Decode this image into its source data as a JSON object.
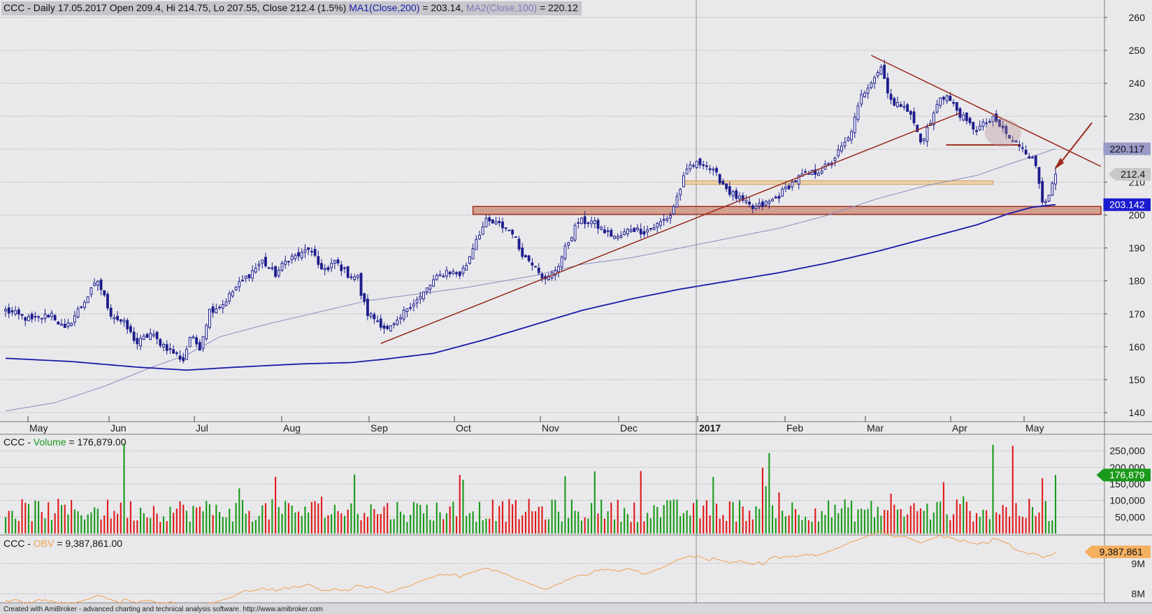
{
  "header": {
    "parts": [
      {
        "text": "CCC - Daily 17.05.2017 Open 209.4, Hi 214.75, Lo 207.55, Close 212.4 (1.5%) ",
        "color": "#111111"
      },
      {
        "text": "MA1(Close,200)",
        "color": "#1a1aa8"
      },
      {
        "text": " = 203.14, ",
        "color": "#111111"
      },
      {
        "text": "MA2(Close,100)",
        "color": "#7a7ab8"
      },
      {
        "text": " = 220.12",
        "color": "#111111"
      }
    ]
  },
  "volume_header": {
    "parts": [
      {
        "text": "CCC - ",
        "color": "#111111"
      },
      {
        "text": "Volume",
        "color": "#1a9a1a"
      },
      {
        "text": " = 176,879.00",
        "color": "#111111"
      }
    ]
  },
  "obv_header": {
    "parts": [
      {
        "text": "CCC - ",
        "color": "#111111"
      },
      {
        "text": "OBV",
        "color": "#f0a050"
      },
      {
        "text": " = 9,387,861.00",
        "color": "#111111"
      }
    ]
  },
  "footer": "Created with AmiBroker - advanced charting and technical analysis software. http://www.amibroker.com",
  "months": [
    {
      "label": "May",
      "bold": false
    },
    {
      "label": "Jun",
      "bold": false
    },
    {
      "label": "Jul",
      "bold": false
    },
    {
      "label": "Aug",
      "bold": false
    },
    {
      "label": "Sep",
      "bold": false
    },
    {
      "label": "Oct",
      "bold": false
    },
    {
      "label": "Nov",
      "bold": false
    },
    {
      "label": "Dec",
      "bold": false
    },
    {
      "label": "2017",
      "bold": true
    },
    {
      "label": "Feb",
      "bold": false
    },
    {
      "label": "Mar",
      "bold": false
    },
    {
      "label": "Apr",
      "bold": false
    },
    {
      "label": "May",
      "bold": false
    }
  ],
  "price_badges": [
    {
      "text": "220.117",
      "bg": "#9a9ac8",
      "fg": "#111111"
    },
    {
      "text": "212.4",
      "bg": "#c8c8c8",
      "fg": "#111111"
    },
    {
      "text": "203.142",
      "bg": "#1a1ad0",
      "fg": "#ffffff"
    }
  ],
  "volume_badge": {
    "text": "176,879",
    "bg": "#1a9a1a",
    "fg": "#ffffff"
  },
  "obv_badge": {
    "text": "9,387,861",
    "bg": "#f5b060",
    "fg": "#111111"
  },
  "colors": {
    "background": "#e9e9ec",
    "grid": "#9a9a9a",
    "candle": "#1c1c8c",
    "ma200": "#1a1aa8",
    "ma100": "#8a8ac0",
    "trendline": "#9a2a1a",
    "support_zone_fill": "#c8806a",
    "resist_zone_fill": "#f0c890",
    "vol_up": "#1a9a1a",
    "vol_down": "#e01a1a",
    "obv_line": "#f0a050"
  },
  "chart_data": [
    {
      "type": "candlestick",
      "title": "CCC - Daily 17.05.2017",
      "period": "2016-05 to 2017-05-17",
      "last": {
        "date": "17.05.2017",
        "open": 209.4,
        "high": 214.75,
        "low": 207.55,
        "close": 212.4,
        "change_pct": 1.5
      },
      "y_ticks": [
        140,
        150,
        160,
        170,
        180,
        190,
        200,
        210,
        220,
        230,
        240,
        250,
        260
      ],
      "ylim": [
        137,
        262
      ],
      "x_months": [
        "May",
        "Jun",
        "Jul",
        "Aug",
        "Sep",
        "Oct",
        "Nov",
        "Dec",
        "2017",
        "Feb",
        "Mar",
        "Apr",
        "May"
      ],
      "close_anchors": [
        [
          0,
          171
        ],
        [
          8,
          168
        ],
        [
          14,
          170
        ],
        [
          18,
          165
        ],
        [
          24,
          174
        ],
        [
          28,
          180
        ],
        [
          32,
          170
        ],
        [
          36,
          167
        ],
        [
          40,
          161
        ],
        [
          44,
          164
        ],
        [
          46,
          162
        ],
        [
          50,
          159
        ],
        [
          54,
          156
        ],
        [
          56,
          163
        ],
        [
          59,
          160
        ],
        [
          62,
          171
        ],
        [
          66,
          173
        ],
        [
          70,
          178
        ],
        [
          74,
          182
        ],
        [
          78,
          186
        ],
        [
          82,
          182
        ],
        [
          86,
          187
        ],
        [
          90,
          188
        ],
        [
          92,
          190
        ],
        [
          95,
          185
        ],
        [
          98,
          183
        ],
        [
          100,
          186
        ],
        [
          104,
          182
        ],
        [
          107,
          181
        ],
        [
          108,
          176
        ],
        [
          110,
          170
        ],
        [
          113,
          168
        ],
        [
          116,
          165
        ],
        [
          119,
          167
        ],
        [
          122,
          172
        ],
        [
          126,
          175
        ],
        [
          130,
          180
        ],
        [
          134,
          183
        ],
        [
          138,
          182
        ],
        [
          140,
          185
        ],
        [
          143,
          193
        ],
        [
          146,
          198
        ],
        [
          150,
          197
        ],
        [
          154,
          195
        ],
        [
          156,
          190
        ],
        [
          158,
          187
        ],
        [
          161,
          185
        ],
        [
          164,
          180
        ],
        [
          166,
          182
        ],
        [
          168,
          185
        ],
        [
          171,
          192
        ],
        [
          174,
          198
        ],
        [
          178,
          198
        ],
        [
          182,
          195
        ],
        [
          186,
          193
        ],
        [
          190,
          196
        ],
        [
          194,
          195
        ],
        [
          198,
          197
        ],
        [
          202,
          200
        ],
        [
          206,
          211
        ],
        [
          208,
          215
        ],
        [
          212,
          216
        ],
        [
          216,
          212
        ],
        [
          220,
          207
        ],
        [
          224,
          204
        ],
        [
          227,
          202
        ],
        [
          230,
          203
        ],
        [
          234,
          205
        ],
        [
          238,
          209
        ],
        [
          242,
          212
        ],
        [
          246,
          213
        ],
        [
          250,
          215
        ],
        [
          253,
          219
        ],
        [
          256,
          223
        ],
        [
          258,
          229
        ],
        [
          260,
          236
        ],
        [
          263,
          241
        ],
        [
          266,
          245
        ],
        [
          268,
          238
        ],
        [
          270,
          233
        ],
        [
          273,
          234
        ],
        [
          276,
          228
        ],
        [
          278,
          222
        ],
        [
          281,
          228
        ],
        [
          284,
          236
        ],
        [
          286,
          236
        ],
        [
          289,
          232
        ],
        [
          292,
          228
        ],
        [
          295,
          226
        ],
        [
          298,
          228
        ],
        [
          300,
          229
        ],
        [
          303,
          226
        ],
        [
          306,
          222
        ],
        [
          309,
          221
        ],
        [
          311,
          218
        ],
        [
          313,
          215
        ],
        [
          315,
          205
        ],
        [
          317,
          205
        ],
        [
          318,
          209
        ],
        [
          319,
          212.4
        ]
      ],
      "ma200": {
        "name": "MA1(Close,200)",
        "last": 203.14,
        "anchors": [
          [
            0,
            156.5
          ],
          [
            20,
            155.5
          ],
          [
            40,
            153.8
          ],
          [
            55,
            152.9
          ],
          [
            70,
            153.8
          ],
          [
            90,
            154.8
          ],
          [
            105,
            155.2
          ],
          [
            115,
            156.2
          ],
          [
            130,
            158
          ],
          [
            145,
            162
          ],
          [
            160,
            166.5
          ],
          [
            175,
            171
          ],
          [
            190,
            174.5
          ],
          [
            205,
            177.5
          ],
          [
            220,
            180
          ],
          [
            235,
            182.5
          ],
          [
            250,
            185.5
          ],
          [
            265,
            189
          ],
          [
            280,
            193
          ],
          [
            295,
            197
          ],
          [
            305,
            200.5
          ],
          [
            312,
            202.4
          ],
          [
            319,
            203.14
          ]
        ]
      },
      "ma100": {
        "name": "MA2(Close,100)",
        "last": 220.12,
        "anchors": [
          [
            0,
            140.5
          ],
          [
            15,
            143
          ],
          [
            30,
            148
          ],
          [
            45,
            154
          ],
          [
            55,
            157.5
          ],
          [
            65,
            163
          ],
          [
            80,
            167
          ],
          [
            95,
            170.5
          ],
          [
            110,
            174
          ],
          [
            125,
            176
          ],
          [
            140,
            178
          ],
          [
            160,
            181.5
          ],
          [
            175,
            185
          ],
          [
            190,
            187
          ],
          [
            205,
            190
          ],
          [
            220,
            193
          ],
          [
            235,
            196
          ],
          [
            250,
            200
          ],
          [
            265,
            205
          ],
          [
            280,
            209
          ],
          [
            295,
            212
          ],
          [
            305,
            215.5
          ],
          [
            319,
            220.12
          ]
        ]
      },
      "annotations": {
        "uptrend_line": [
          [
            114,
            161
          ],
          [
            290,
            231
          ]
        ],
        "downtrend_line": [
          [
            263,
            248.5
          ],
          [
            319,
            219
          ]
        ],
        "support_zone": [
          [
            142,
            200.2
          ],
          [
            319,
            202.6
          ]
        ],
        "resistance_zone": [
          [
            206,
            209.3
          ],
          [
            300,
            210.4
          ]
        ],
        "hline_short": [
          [
            290,
            221.3
          ],
          [
            306,
            221.3
          ]
        ]
      }
    },
    {
      "type": "bar",
      "title": "CCC - Volume = 176,879.00",
      "last": 176879,
      "y_ticks": [
        50000,
        100000,
        150000,
        200000,
        250000
      ],
      "y_tick_labels": [
        "50,000",
        "100,000",
        "150,000",
        "200,000",
        "250,000"
      ],
      "ylim": [
        0,
        285000
      ]
    },
    {
      "type": "line",
      "title": "CCC - OBV = 9,387,861.00",
      "last": 9387861,
      "y_ticks": [
        8000000,
        9000000
      ],
      "y_tick_labels": [
        "8M",
        "9M"
      ],
      "ylim": [
        7700000,
        9900000
      ]
    }
  ]
}
